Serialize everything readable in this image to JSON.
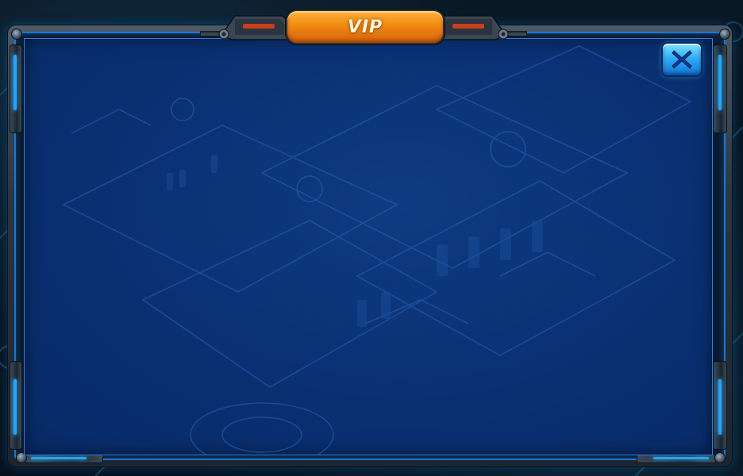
{
  "dialog": {
    "title": "VIP",
    "close_icon": "close-x-icon"
  },
  "colors": {
    "panel_blue": "#0a3276",
    "title_orange": "#f08a12",
    "close_blue": "#31aef5",
    "frame_steel": "#2a3540",
    "accent_glow": "#23a6ff"
  }
}
